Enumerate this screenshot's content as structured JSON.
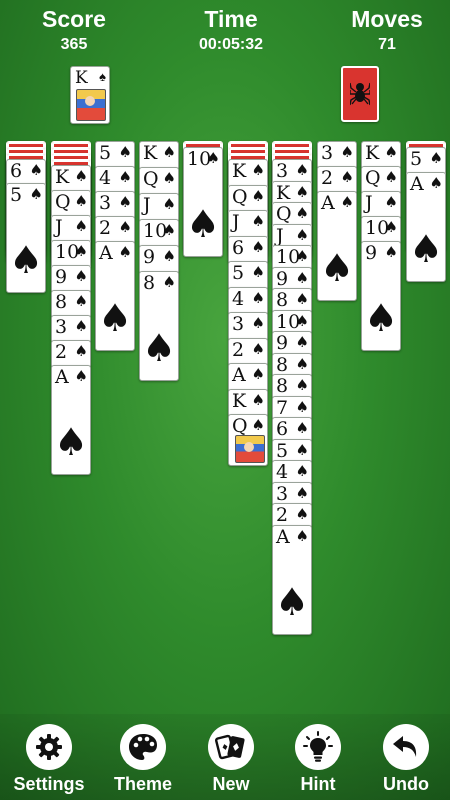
{
  "hud": {
    "score_label": "Score",
    "score": "365",
    "time_label": "Time",
    "time": "00:05:32",
    "moves_label": "Moves",
    "moves": "71"
  },
  "completed_foundation": {
    "rank": "K",
    "suit": "♠"
  },
  "stock": {
    "icon": "spider-icon",
    "color": "#d9342f"
  },
  "suit_symbol": "♠",
  "columns": [
    {
      "backs": 3,
      "cards": [
        "6",
        "5"
      ]
    },
    {
      "backs": 4,
      "cards": [
        "K",
        "Q",
        "J",
        "10",
        "9",
        "8",
        "3",
        "2",
        "A"
      ]
    },
    {
      "backs": 0,
      "cards": [
        "5",
        "4",
        "3",
        "2",
        "A"
      ]
    },
    {
      "backs": 0,
      "cards": [
        "K",
        "Q",
        "J",
        "10",
        "9",
        "8"
      ]
    },
    {
      "backs": 1,
      "cards": [
        "10"
      ]
    },
    {
      "backs": 3,
      "cards": [
        "K",
        "Q",
        "J",
        "6",
        "5",
        "4",
        "3",
        "2",
        "A",
        "K",
        "Q"
      ]
    },
    {
      "backs": 3,
      "cards": [
        "3",
        "K",
        "Q",
        "J",
        "10",
        "9",
        "8",
        "10",
        "9",
        "8",
        "8",
        "7",
        "6",
        "5",
        "4",
        "3",
        "2",
        "A"
      ]
    },
    {
      "backs": 0,
      "cards": [
        "3",
        "2",
        "A"
      ]
    },
    {
      "backs": 0,
      "cards": [
        "K",
        "Q",
        "J",
        "10",
        "9"
      ]
    },
    {
      "backs": 1,
      "cards": [
        "5",
        "A"
      ]
    }
  ],
  "toolbar": [
    {
      "id": "settings",
      "label": "Settings",
      "icon": "gear-icon"
    },
    {
      "id": "theme",
      "label": "Theme",
      "icon": "palette-icon"
    },
    {
      "id": "new",
      "label": "New",
      "icon": "cards-icon"
    },
    {
      "id": "hint",
      "label": "Hint",
      "icon": "lightbulb-icon"
    },
    {
      "id": "undo",
      "label": "Undo",
      "icon": "undo-arrow-icon"
    }
  ]
}
